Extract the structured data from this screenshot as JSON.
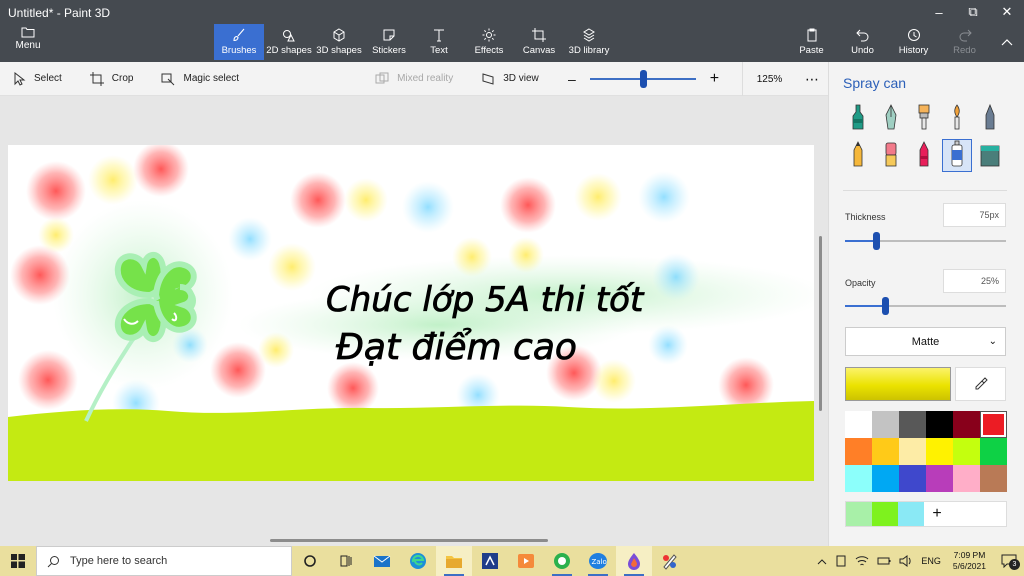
{
  "window": {
    "title": "Untitled* - Paint 3D"
  },
  "topbar": {
    "menu_label": "Menu",
    "tools": [
      {
        "label": "Brushes",
        "icon": "brush-icon",
        "active": true
      },
      {
        "label": "2D shapes",
        "icon": "shapes-2d-icon"
      },
      {
        "label": "3D shapes",
        "icon": "cube-icon"
      },
      {
        "label": "Stickers",
        "icon": "sticker-icon"
      },
      {
        "label": "Text",
        "icon": "text-icon"
      },
      {
        "label": "Effects",
        "icon": "sun-icon"
      },
      {
        "label": "Canvas",
        "icon": "canvas-crop-icon"
      },
      {
        "label": "3D library",
        "icon": "library-icon"
      }
    ],
    "paste_label": "Paste",
    "undo_label": "Undo",
    "history_label": "History",
    "redo_label": "Redo"
  },
  "subbar": {
    "select_label": "Select",
    "crop_label": "Crop",
    "magic_select_label": "Magic select",
    "mixed_reality_label": "Mixed reality",
    "view3d_label": "3D view",
    "zoom_value": "125%",
    "zoom_level": 0.5
  },
  "canvas": {
    "line1": "Chúc lớp 5A thi tốt",
    "line2": "Đạt điểm cao"
  },
  "panel": {
    "title": "Spray can",
    "brushes": [
      "marker-icon",
      "calligraphy-pen-icon",
      "oil-brush-icon",
      "watercolor-icon",
      "pixel-pen-icon",
      "pencil-icon",
      "eraser-icon",
      "crayon-icon",
      "spray-can-icon",
      "fill-icon"
    ],
    "active_brush": 8,
    "thickness_label": "Thickness",
    "thickness_value": "75px",
    "thickness_level": 0.19,
    "opacity_label": "Opacity",
    "opacity_value": "25%",
    "opacity_level": 0.25,
    "finish_value": "Matte",
    "current_color": "#ebe200",
    "palette": [
      "#ffffff",
      "#c3c3c3",
      "#585858",
      "#000000",
      "#88001b",
      "#ec1c24",
      "#ff7f27",
      "#ffca18",
      "#fdeca6",
      "#fff200",
      "#c4ff0e",
      "#0ed145",
      "#8cfffb",
      "#00a8f3",
      "#3f48cc",
      "#b83dba",
      "#ffaec8",
      "#b97a56"
    ],
    "selected_palette": 5,
    "custom_colors": [
      "#a8f0a8",
      "#7ef21e",
      "#8ae9f5"
    ],
    "add_label": "+"
  },
  "taskbar": {
    "search_placeholder": "Type here to search",
    "apps": [
      "cortana-icon",
      "task-view-icon",
      "mail-icon",
      "edge-icon",
      "file-explorer-icon",
      "vlc-kanji-icon",
      "media-player-icon",
      "coccoc-icon",
      "zalo-icon",
      "paint3d-icon",
      "paint-icon"
    ],
    "language": "ENG",
    "time": "7:09 PM",
    "date": "5/6/2021",
    "notification_count": "3"
  }
}
